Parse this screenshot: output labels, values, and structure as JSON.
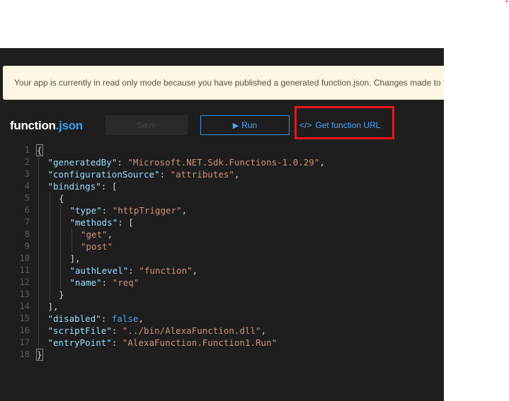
{
  "banner": {
    "text": "Your app is currently in read only mode because you have published a generated function.json. Changes made to function.json will not be honored."
  },
  "toolbar": {
    "title_name": "function",
    "title_ext": ".json",
    "save_label": "Save",
    "run_label": "Run",
    "run_icon": "play-icon",
    "get_url_icon": "code-icon",
    "get_url_icon_glyph": "</>",
    "get_url_label": "Get function URL"
  },
  "editor": {
    "lines": [
      {
        "n": "1",
        "indent": 0,
        "tokens": [
          {
            "t": "{",
            "c": "p"
          }
        ]
      },
      {
        "n": "2",
        "indent": 1,
        "tokens": [
          {
            "t": "\"generatedBy\"",
            "c": "k"
          },
          {
            "t": ": ",
            "c": "p"
          },
          {
            "t": "\"Microsoft.NET.Sdk.Functions-1.0.29\"",
            "c": "s"
          },
          {
            "t": ",",
            "c": "p"
          }
        ]
      },
      {
        "n": "3",
        "indent": 1,
        "tokens": [
          {
            "t": "\"configurationSource\"",
            "c": "k"
          },
          {
            "t": ": ",
            "c": "p"
          },
          {
            "t": "\"attributes\"",
            "c": "s"
          },
          {
            "t": ",",
            "c": "p"
          }
        ]
      },
      {
        "n": "4",
        "indent": 1,
        "tokens": [
          {
            "t": "\"bindings\"",
            "c": "k"
          },
          {
            "t": ": [",
            "c": "p"
          }
        ]
      },
      {
        "n": "5",
        "indent": 2,
        "tokens": [
          {
            "t": "{",
            "c": "p"
          }
        ]
      },
      {
        "n": "6",
        "indent": 3,
        "tokens": [
          {
            "t": "\"type\"",
            "c": "k"
          },
          {
            "t": ": ",
            "c": "p"
          },
          {
            "t": "\"httpTrigger\"",
            "c": "s"
          },
          {
            "t": ",",
            "c": "p"
          }
        ]
      },
      {
        "n": "7",
        "indent": 3,
        "tokens": [
          {
            "t": "\"methods\"",
            "c": "k"
          },
          {
            "t": ": [",
            "c": "p"
          }
        ]
      },
      {
        "n": "8",
        "indent": 4,
        "tokens": [
          {
            "t": "\"get\"",
            "c": "s"
          },
          {
            "t": ",",
            "c": "p"
          }
        ]
      },
      {
        "n": "9",
        "indent": 4,
        "tokens": [
          {
            "t": "\"post\"",
            "c": "s"
          }
        ]
      },
      {
        "n": "10",
        "indent": 3,
        "tokens": [
          {
            "t": "],",
            "c": "p"
          }
        ]
      },
      {
        "n": "11",
        "indent": 3,
        "tokens": [
          {
            "t": "\"authLevel\"",
            "c": "k"
          },
          {
            "t": ": ",
            "c": "p"
          },
          {
            "t": "\"function\"",
            "c": "s"
          },
          {
            "t": ",",
            "c": "p"
          }
        ]
      },
      {
        "n": "12",
        "indent": 3,
        "tokens": [
          {
            "t": "\"name\"",
            "c": "k"
          },
          {
            "t": ": ",
            "c": "p"
          },
          {
            "t": "\"req\"",
            "c": "s"
          }
        ]
      },
      {
        "n": "13",
        "indent": 2,
        "tokens": [
          {
            "t": "}",
            "c": "p"
          }
        ]
      },
      {
        "n": "14",
        "indent": 1,
        "tokens": [
          {
            "t": "],",
            "c": "p"
          }
        ]
      },
      {
        "n": "15",
        "indent": 1,
        "tokens": [
          {
            "t": "\"disabled\"",
            "c": "k"
          },
          {
            "t": ": ",
            "c": "p"
          },
          {
            "t": "false",
            "c": "b"
          },
          {
            "t": ",",
            "c": "p"
          }
        ]
      },
      {
        "n": "16",
        "indent": 1,
        "tokens": [
          {
            "t": "\"scriptFile\"",
            "c": "k"
          },
          {
            "t": ": ",
            "c": "p"
          },
          {
            "t": "\"../bin/AlexaFunction.dll\"",
            "c": "s"
          },
          {
            "t": ",",
            "c": "p"
          }
        ]
      },
      {
        "n": "17",
        "indent": 1,
        "tokens": [
          {
            "t": "\"entryPoint\"",
            "c": "k"
          },
          {
            "t": ": ",
            "c": "p"
          },
          {
            "t": "\"AlexaFunction.Function1.Run\"",
            "c": "s"
          }
        ]
      },
      {
        "n": "18",
        "indent": 0,
        "tokens": [
          {
            "t": "}",
            "c": "p"
          }
        ]
      }
    ]
  },
  "colors": {
    "panel_bg": "#1e1e1e",
    "banner_bg": "#fdf6e3",
    "accent_blue": "#4fa3f7",
    "highlight_red": "#e8141c"
  }
}
